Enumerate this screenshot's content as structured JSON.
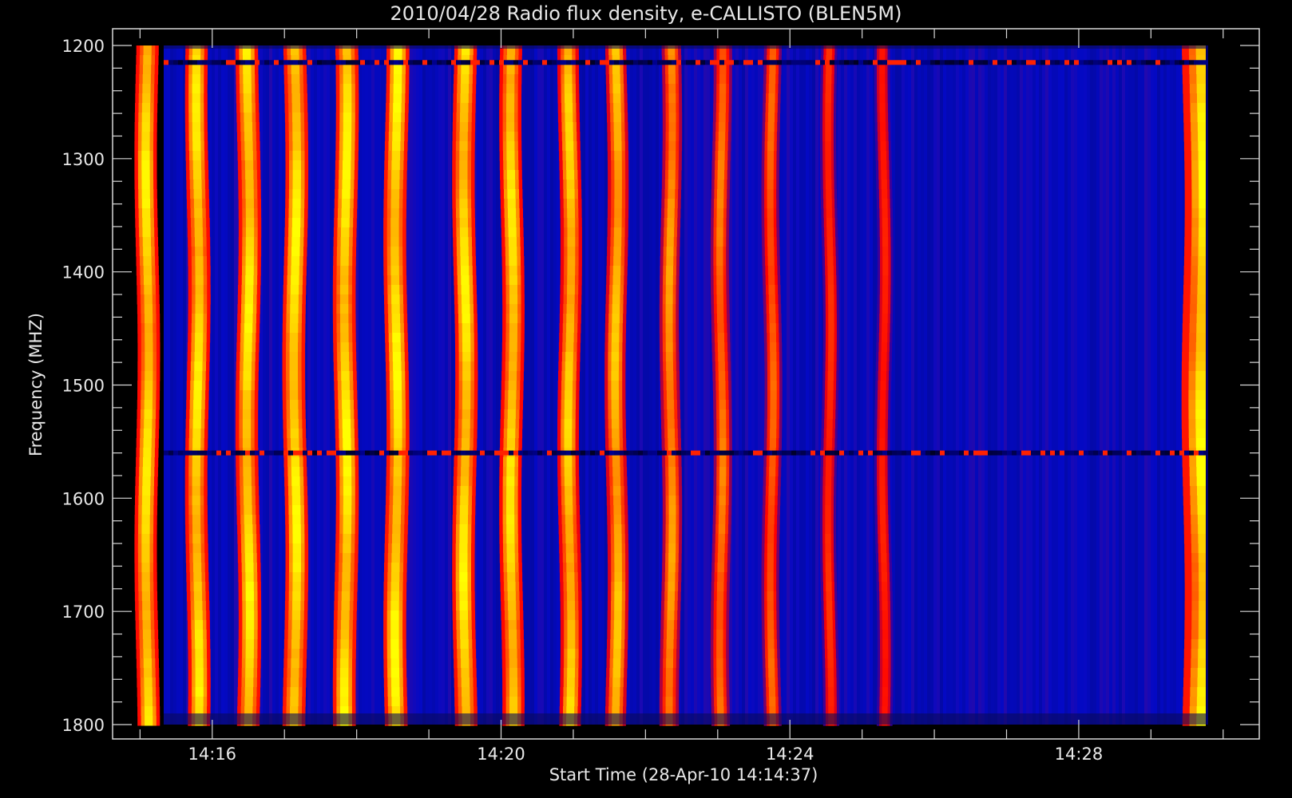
{
  "chart_data": {
    "type": "heatmap",
    "title": "2010/04/28  Radio flux density, e-CALLISTO (BLEN5M)",
    "xlabel": "Start Time (28-Apr-10 14:14:37)",
    "ylabel": "Frequency (MHZ)",
    "x_tick_labels": [
      "14:16",
      "14:20",
      "14:24",
      "14:28"
    ],
    "y_tick_labels": [
      "1200",
      "1300",
      "1400",
      "1500",
      "1600",
      "1700",
      "1800"
    ],
    "xlim_minutes": [
      14.62,
      30.5
    ],
    "ylim_mhz": [
      1200,
      1800
    ],
    "y_inverted": true,
    "colormap": [
      "#000000",
      "#0000c8",
      "#ff0000",
      "#ff9900",
      "#ffff00"
    ],
    "background_color": "#0a14c0",
    "bursts": [
      {
        "t": 15.1,
        "intensity": 0.95
      },
      {
        "t": 15.8,
        "intensity": 0.95
      },
      {
        "t": 16.5,
        "intensity": 0.97
      },
      {
        "t": 17.15,
        "intensity": 1.0
      },
      {
        "t": 17.85,
        "intensity": 1.0
      },
      {
        "t": 18.55,
        "intensity": 1.0
      },
      {
        "t": 19.5,
        "intensity": 0.97
      },
      {
        "t": 20.15,
        "intensity": 0.93
      },
      {
        "t": 20.95,
        "intensity": 0.85
      },
      {
        "t": 21.6,
        "intensity": 0.78
      },
      {
        "t": 22.35,
        "intensity": 0.62
      },
      {
        "t": 23.05,
        "intensity": 0.5
      },
      {
        "t": 23.75,
        "intensity": 0.42
      },
      {
        "t": 24.55,
        "intensity": 0.25
      },
      {
        "t": 25.3,
        "intensity": 0.2
      },
      {
        "t": 29.75,
        "intensity": 1.0
      }
    ],
    "rfi_lines_mhz": [
      1215,
      1560
    ]
  }
}
